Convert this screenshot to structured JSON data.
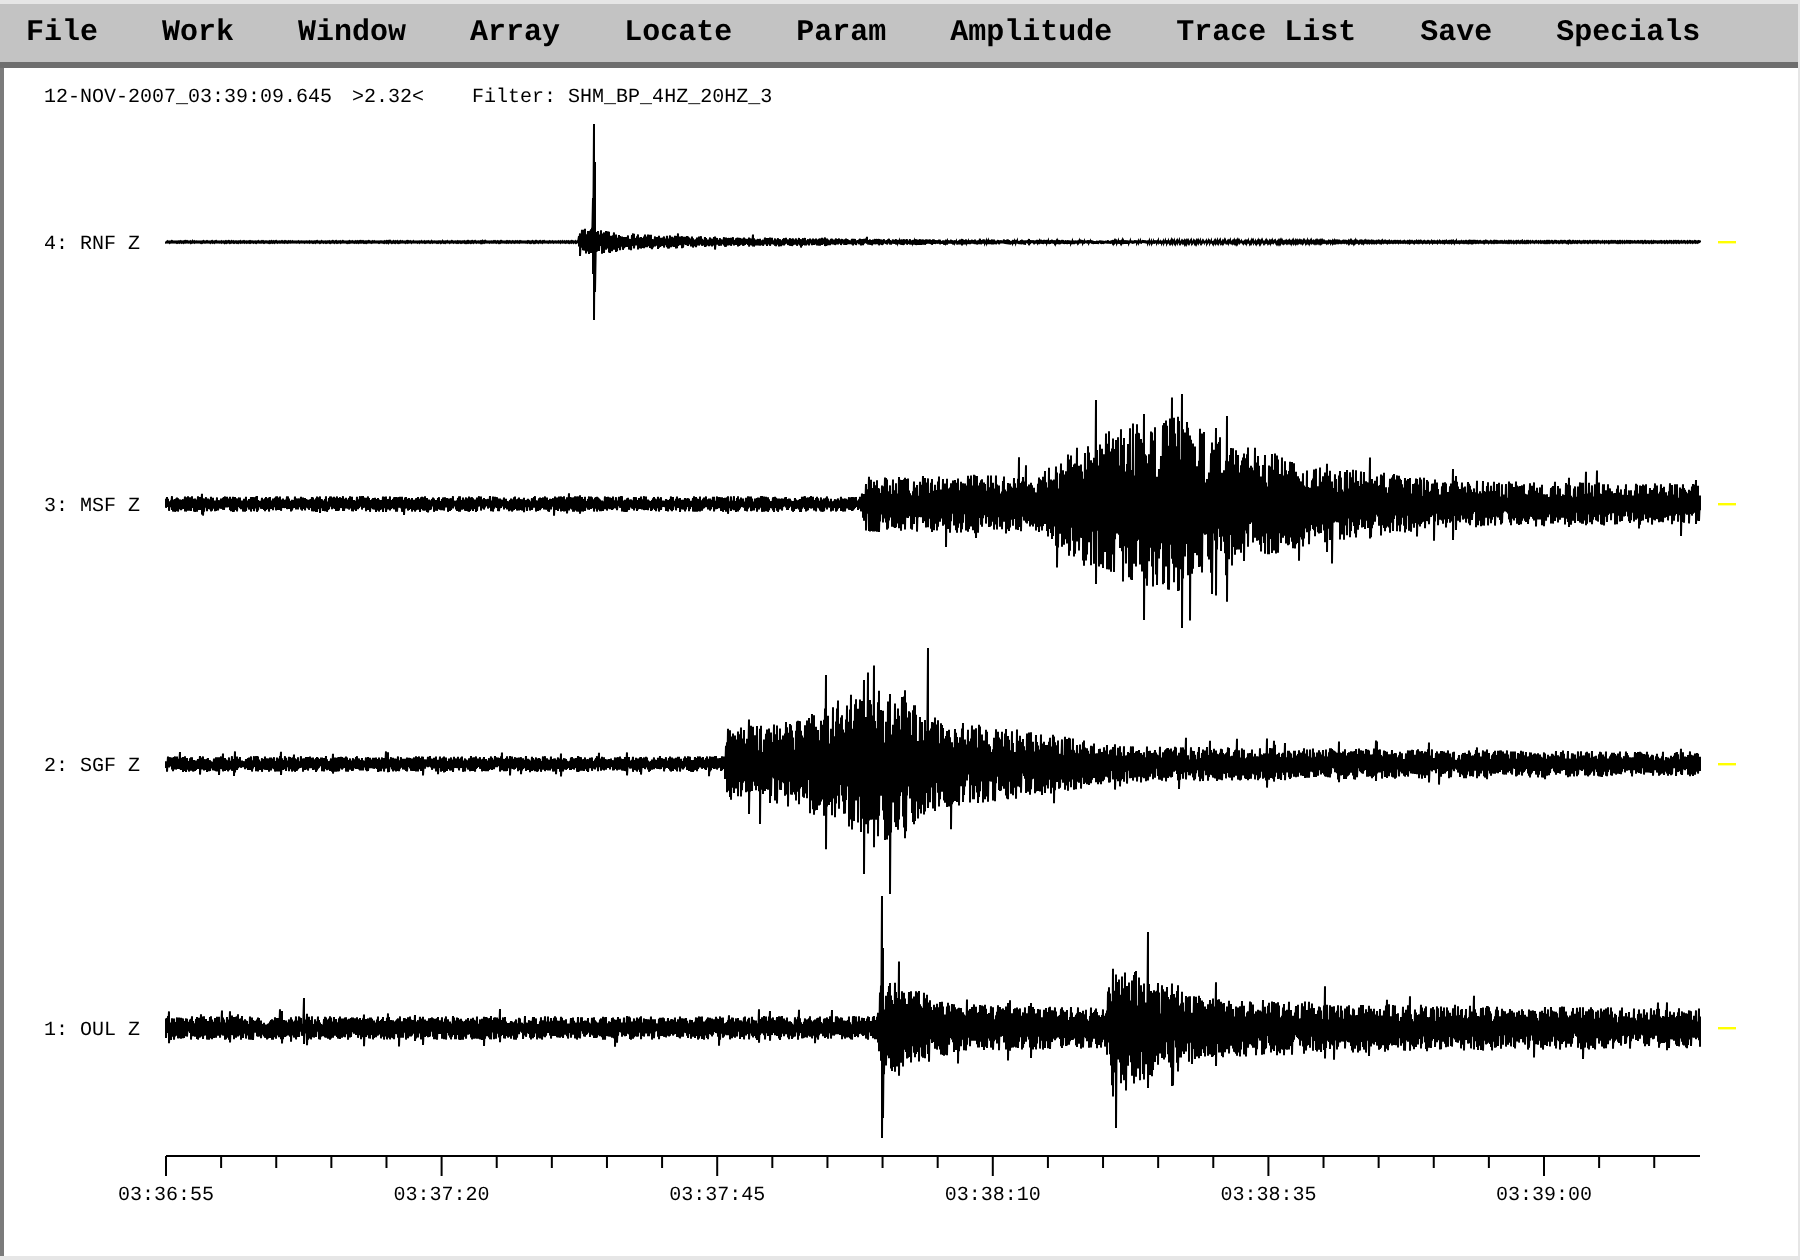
{
  "menu": [
    "File",
    "Work",
    "Window",
    "Array",
    "Locate",
    "Param",
    "Amplitude",
    "Trace List",
    "Save",
    "Specials"
  ],
  "header": {
    "timestamp": "12-NOV-2007_03:39:09.645",
    "amplitude": ">2.32<",
    "filter": "Filter: SHM_BP_4HZ_20HZ_3"
  },
  "traces": [
    {
      "label": "4: RNF Z"
    },
    {
      "label": "3: MSF Z"
    },
    {
      "label": "2: SGF Z"
    },
    {
      "label": "1: OUL Z"
    }
  ],
  "time_axis": {
    "ticks": [
      "03:36:55",
      "03:37:20",
      "03:37:45",
      "03:38:10",
      "03:38:35",
      "03:39:00"
    ]
  }
}
